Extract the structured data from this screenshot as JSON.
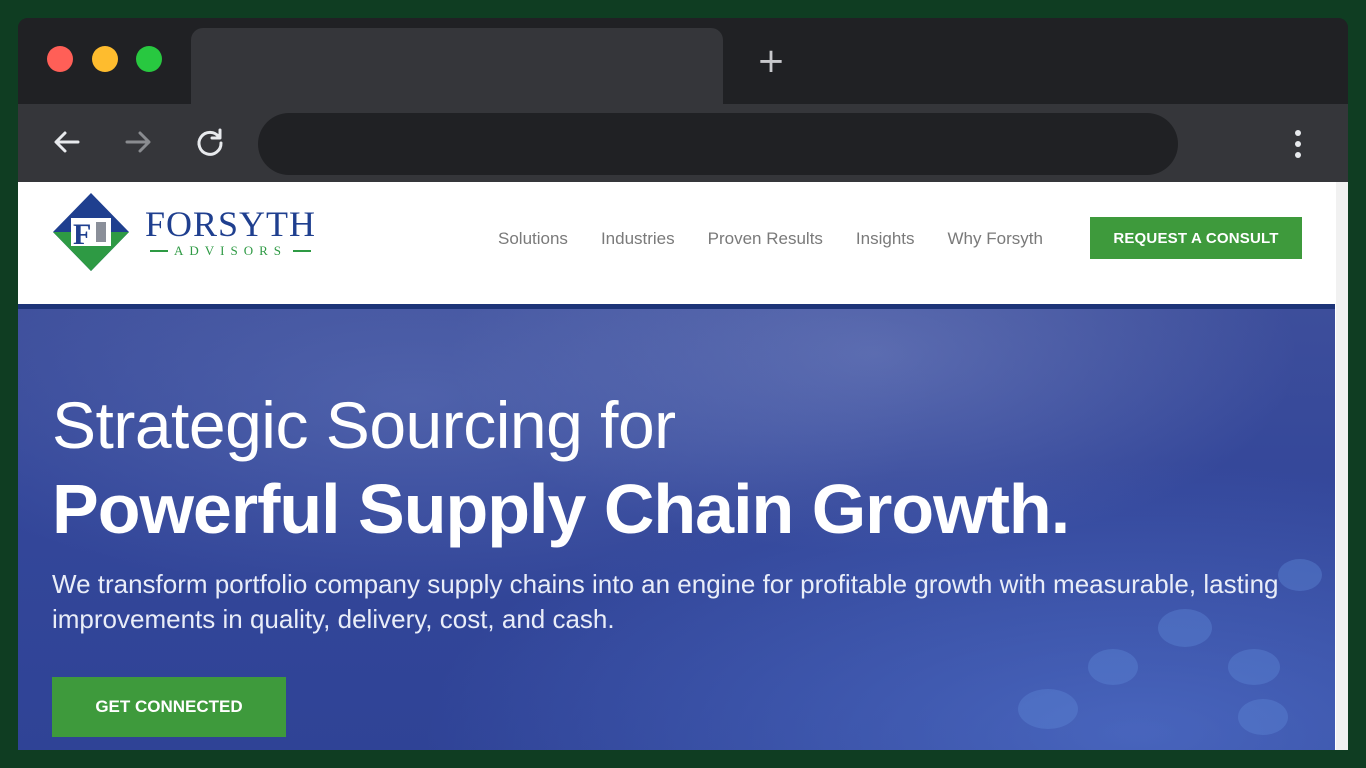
{
  "browser": {
    "tab_title": "",
    "url": "",
    "new_tab_label": "+"
  },
  "site": {
    "logo": {
      "monogram": "F",
      "name": "FORSYTH",
      "subtitle": "ADVISORS"
    },
    "nav": [
      {
        "label": "Solutions"
      },
      {
        "label": "Industries"
      },
      {
        "label": "Proven Results"
      },
      {
        "label": "Insights"
      },
      {
        "label": "Why Forsyth"
      }
    ],
    "cta_label": "REQUEST A CONSULT"
  },
  "hero": {
    "headline_line1": "Strategic Sourcing for",
    "headline_line2": "Powerful Supply Chain Growth.",
    "body": "We transform portfolio company supply chains into an engine for profitable growth with measurable, lasting improvements in quality, delivery, cost, and cash.",
    "cta_label": "GET CONNECTED"
  },
  "colors": {
    "brand_blue": "#1f3f8f",
    "brand_green": "#3e9a3c",
    "hero_blue": "#34479a"
  },
  "icons": {
    "back": "arrow-left-icon",
    "forward": "arrow-right-icon",
    "reload": "reload-icon",
    "menu": "kebab-menu-icon"
  }
}
